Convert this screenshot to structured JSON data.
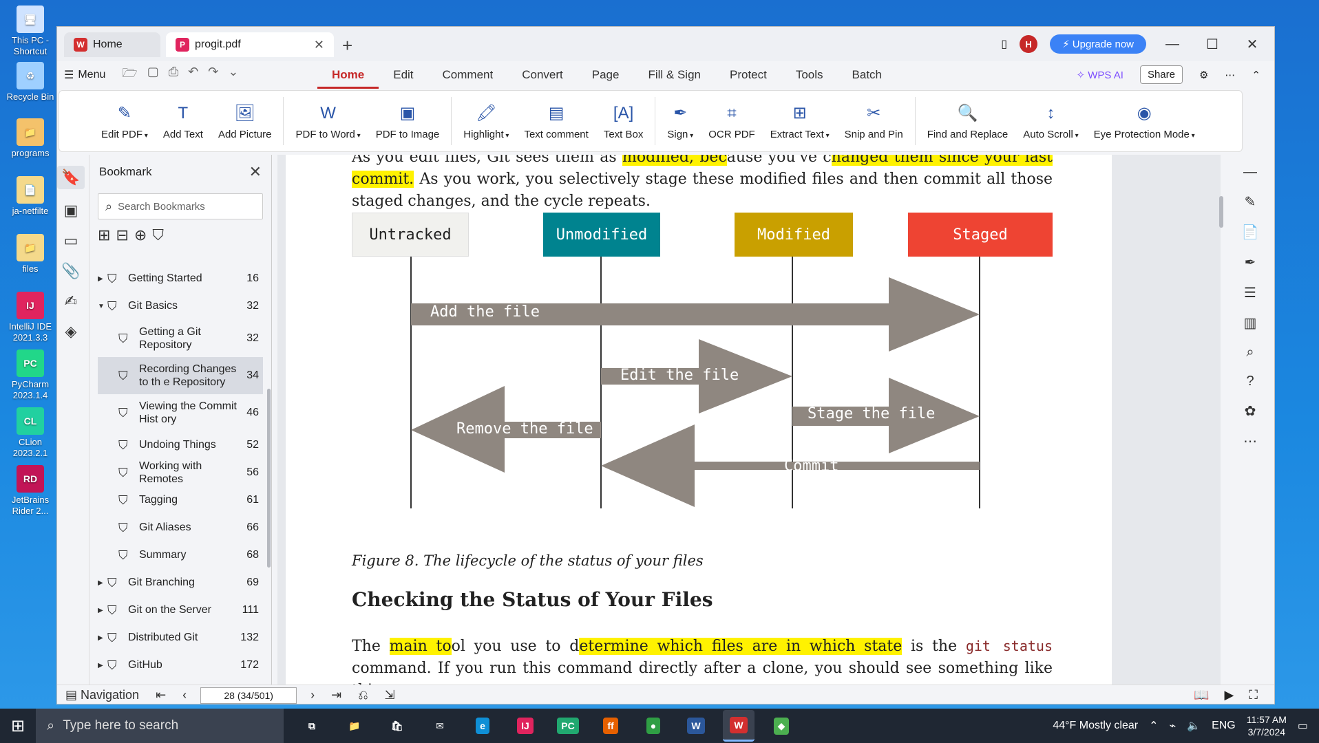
{
  "desktop": {
    "icons": [
      {
        "label": "This PC - Shortcut",
        "color": "#cfe3ff",
        "glyph": "🖥"
      },
      {
        "label": "Recycle Bin",
        "color": "#9fd0ff",
        "glyph": "♻"
      },
      {
        "label": "programs",
        "color": "#f4c26b",
        "glyph": "📁"
      },
      {
        "label": "ja-netfilte",
        "color": "#f4d98b",
        "glyph": "📄"
      },
      {
        "label": "files",
        "color": "#f4d98b",
        "glyph": "📁"
      },
      {
        "label": "IntelliJ IDE 2021.3.3",
        "color": "#e0245e",
        "glyph": "IJ"
      },
      {
        "label": "PyCharm 2023.1.4",
        "color": "#21d789",
        "glyph": "PC"
      },
      {
        "label": "CLion 2023.2.1",
        "color": "#21d0a0",
        "glyph": "CL"
      },
      {
        "label": "JetBrains Rider 2...",
        "color": "#c21456",
        "glyph": "RD"
      }
    ]
  },
  "titlebar": {
    "home_tab": "Home",
    "doc_tab": "progit.pdf",
    "upgrade": "Upgrade now",
    "avatar": "H"
  },
  "menubar": {
    "menu": "Menu",
    "tabs": [
      "Home",
      "Edit",
      "Comment",
      "Convert",
      "Page",
      "Fill & Sign",
      "Protect",
      "Tools",
      "Batch"
    ],
    "wps_ai": "WPS AI",
    "share": "Share"
  },
  "toolbar": {
    "tools": [
      {
        "label": "Edit PDF",
        "icon": "✎",
        "dropdown": true
      },
      {
        "label": "Add Text",
        "icon": "T",
        "dropdown": false
      },
      {
        "label": "Add Picture",
        "icon": "🖼",
        "dropdown": false
      },
      {
        "label": "PDF to Word",
        "icon": "W",
        "dropdown": true
      },
      {
        "label": "PDF to Image",
        "icon": "▣",
        "dropdown": false
      },
      {
        "label": "Highlight",
        "icon": "🖍",
        "dropdown": true
      },
      {
        "label": "Text comment",
        "icon": "▤",
        "dropdown": false
      },
      {
        "label": "Text Box",
        "icon": "[A]",
        "dropdown": false
      },
      {
        "label": "Sign",
        "icon": "✒",
        "dropdown": true
      },
      {
        "label": "OCR PDF",
        "icon": "⌗",
        "dropdown": false
      },
      {
        "label": "Extract Text",
        "icon": "⊞",
        "dropdown": true
      },
      {
        "label": "Snip and Pin",
        "icon": "✂",
        "dropdown": false
      },
      {
        "label": "Find and Replace",
        "icon": "🔍",
        "dropdown": false
      },
      {
        "label": "Auto Scroll",
        "icon": "↕",
        "dropdown": true
      },
      {
        "label": "Eye Protection Mode",
        "icon": "◉",
        "dropdown": true
      }
    ]
  },
  "bookmark": {
    "title": "Bookmark",
    "search_placeholder": "Search Bookmarks",
    "items": [
      {
        "label": "Getting Started",
        "page": "16",
        "level": 0,
        "arrow": "▶"
      },
      {
        "label": "Git Basics",
        "page": "32",
        "level": 0,
        "arrow": "▼"
      },
      {
        "label": "Getting a Git Repository",
        "page": "32",
        "level": 1,
        "arrow": ""
      },
      {
        "label": "Recording Changes to th e Repository",
        "page": "34",
        "level": 1,
        "arrow": "",
        "selected": true
      },
      {
        "label": "Viewing the Commit Hist ory",
        "page": "46",
        "level": 1,
        "arrow": ""
      },
      {
        "label": "Undoing Things",
        "page": "52",
        "level": 1,
        "arrow": ""
      },
      {
        "label": "Working with Remotes",
        "page": "56",
        "level": 1,
        "arrow": ""
      },
      {
        "label": "Tagging",
        "page": "61",
        "level": 1,
        "arrow": ""
      },
      {
        "label": "Git Aliases",
        "page": "66",
        "level": 1,
        "arrow": ""
      },
      {
        "label": "Summary",
        "page": "68",
        "level": 1,
        "arrow": ""
      },
      {
        "label": "Git Branching",
        "page": "69",
        "level": 0,
        "arrow": "▶"
      },
      {
        "label": "Git on the Server",
        "page": "111",
        "level": 0,
        "arrow": "▶"
      },
      {
        "label": "Distributed Git",
        "page": "132",
        "level": 0,
        "arrow": "▶"
      },
      {
        "label": "GitHub",
        "page": "172",
        "level": 0,
        "arrow": "▶"
      }
    ]
  },
  "document": {
    "para1_a": "As you edit files, Git sees them as ",
    "para1_hl1": "modified, bec",
    "para1_b": "ause you've c",
    "para1_hl2": "hanged them since your last commit.",
    "para1_c": " As you work, you selectively stage these modified files and then commit all those staged changes, and the cycle repeats.",
    "states": [
      "Untracked",
      "Unmodified",
      "Modified",
      "Staged"
    ],
    "arrows": [
      "Add the file",
      "Edit the file",
      "Stage the file",
      "Remove the file",
      "Commit"
    ],
    "caption": "Figure 8. The lifecycle of the status of your files",
    "heading": "Checking the Status of Your Files",
    "para2_a": "The ",
    "para2_hl1": "main to",
    "para2_b": "ol you use to d",
    "para2_hl2": "etermine which files are in which state",
    "para2_c": " is the ",
    "para2_code": "git status",
    "para2_d": " command. If you run this command directly after a clone, you should see something like this:"
  },
  "statusbar": {
    "navigation": "Navigation",
    "page_value": "28 (34/501)"
  },
  "taskbar": {
    "search_placeholder": "Type here to search",
    "weather": "44°F  Mostly clear",
    "lang": "ENG",
    "time": "11:57 AM",
    "date": "3/7/2024",
    "apps": [
      {
        "name": "task-view",
        "glyph": "⧉",
        "bg": "transparent"
      },
      {
        "name": "file-explorer",
        "glyph": "📁",
        "bg": "transparent"
      },
      {
        "name": "store",
        "glyph": "🛍",
        "bg": "transparent"
      },
      {
        "name": "mail",
        "glyph": "✉",
        "bg": "transparent"
      },
      {
        "name": "edge",
        "glyph": "e",
        "bg": "#0f8fd6"
      },
      {
        "name": "intellij",
        "glyph": "IJ",
        "bg": "#e0245e"
      },
      {
        "name": "pycharm",
        "glyph": "PC",
        "bg": "#21a870"
      },
      {
        "name": "firefox",
        "glyph": "ff",
        "bg": "#e66000"
      },
      {
        "name": "chrome",
        "glyph": "●",
        "bg": "#2f9e44"
      },
      {
        "name": "word",
        "glyph": "W",
        "bg": "#2b579a"
      },
      {
        "name": "wps",
        "glyph": "W",
        "bg": "#d32f2f",
        "active": true
      },
      {
        "name": "git-gui",
        "glyph": "◆",
        "bg": "#4caf50"
      }
    ]
  },
  "colors": {
    "accent": "#c62828",
    "unmodified": "#00838f",
    "modified": "#c9a000",
    "staged": "#ee4433",
    "arrow_gray": "#8f8780"
  }
}
